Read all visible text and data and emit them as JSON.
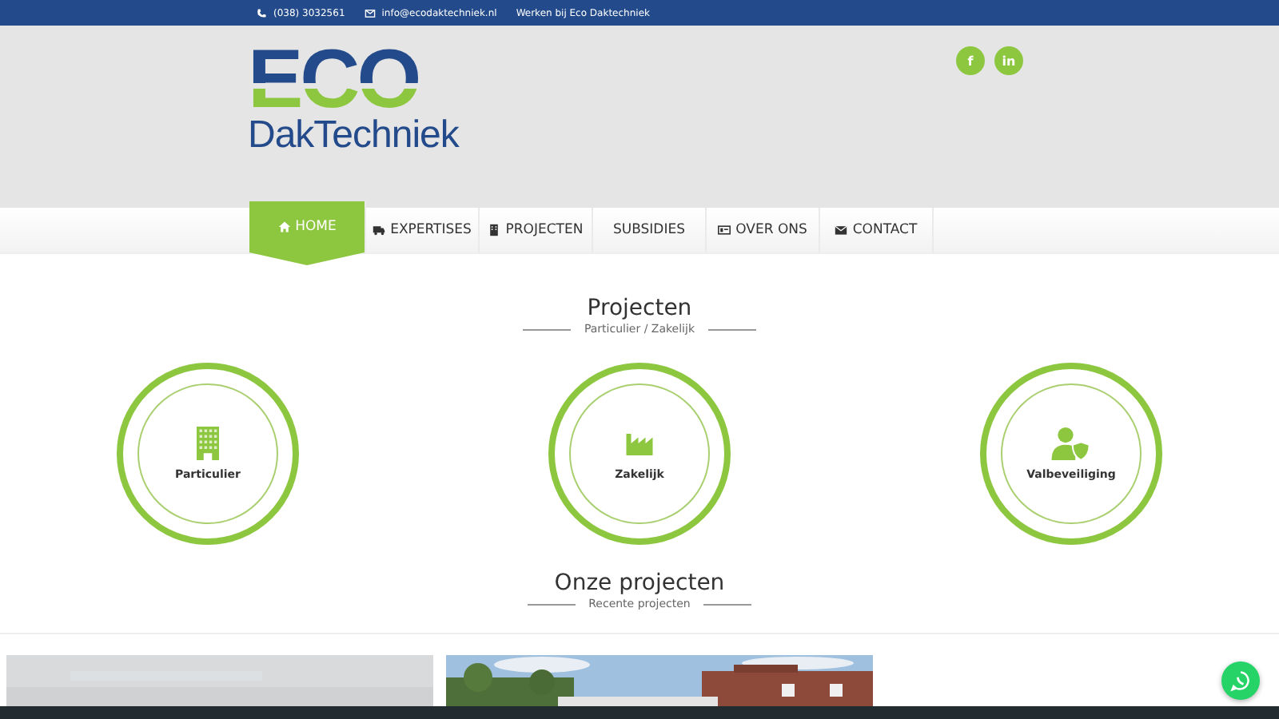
{
  "topbar": {
    "phone": "(038) 3032561",
    "email": "info@ecodaktechniek.nl",
    "link": "Werken bij Eco Daktechniek"
  },
  "logo": {
    "mark": "ECO",
    "name": "DakTechniek"
  },
  "social": [
    {
      "label": "f"
    },
    {
      "label": "in"
    }
  ],
  "nav": [
    {
      "label": "HOME",
      "kind": "home",
      "selected": true
    },
    {
      "label": "EXPERTISES",
      "kind": "truck",
      "selected": false
    },
    {
      "label": "PROJECTEN",
      "kind": "building",
      "selected": false
    },
    {
      "label": "SUBSIDIES",
      "kind": "plain",
      "selected": false
    },
    {
      "label": "OVER ONS",
      "kind": "card",
      "selected": false
    },
    {
      "label": "CONTACT",
      "kind": "mail",
      "selected": false
    }
  ],
  "projects_section": {
    "title": "Projecten",
    "subtitle": "Particulier / Zakelijk",
    "categories": [
      {
        "label": "Particulier",
        "kind": "building"
      },
      {
        "label": "Zakelijk",
        "kind": "factory"
      },
      {
        "label": "Valbeveiliging",
        "kind": "shield"
      }
    ]
  },
  "recent_section": {
    "title": "Onze projecten",
    "subtitle": "Recente projecten"
  }
}
